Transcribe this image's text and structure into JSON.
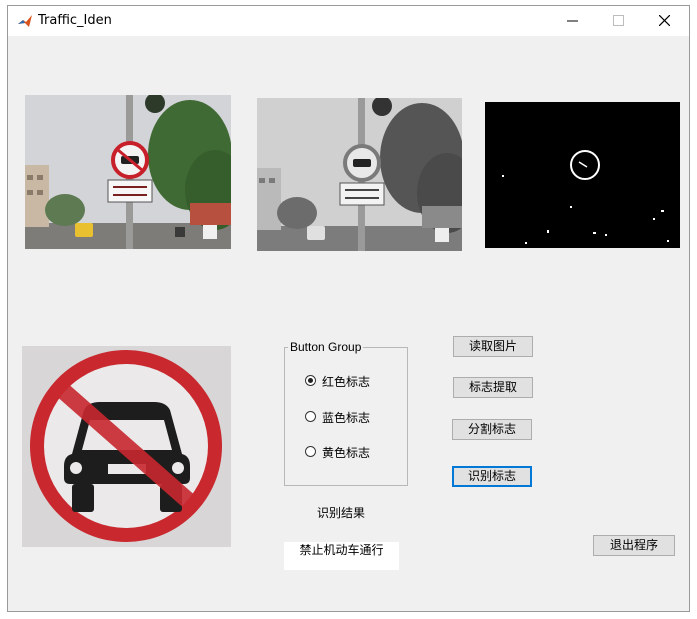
{
  "window": {
    "title": "Traffic_Iden"
  },
  "images": {
    "original": "original-sign-photo",
    "grayscale": "grayscale-sign-photo",
    "binary": "binary-mask",
    "extracted": "extracted-sign"
  },
  "button_group": {
    "title": "Button Group",
    "options": [
      {
        "label": "红色标志",
        "selected": true
      },
      {
        "label": "蓝色标志",
        "selected": false
      },
      {
        "label": "黄色标志",
        "selected": false
      }
    ]
  },
  "buttons": {
    "read_image": "读取图片",
    "extract_sign": "标志提取",
    "segment_sign": "分割标志",
    "recognize_sign": "识别标志",
    "exit": "退出程序"
  },
  "result": {
    "label": "识别结果",
    "value": "禁止机动车通行"
  }
}
